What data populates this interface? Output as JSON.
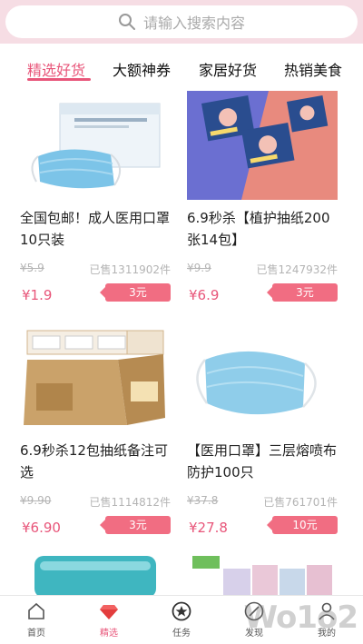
{
  "search": {
    "placeholder": "请输入搜索内容"
  },
  "tabs": [
    {
      "label": "精选好货"
    },
    {
      "label": "大额神券"
    },
    {
      "label": "家居好货"
    },
    {
      "label": "热销美食"
    }
  ],
  "products": [
    {
      "title": "全国包邮！成人医用口罩10只装",
      "orig_price": "¥5.9",
      "sold": "已售1311902件",
      "price": "¥1.9",
      "coupon": "3元"
    },
    {
      "title": "6.9秒杀【植护抽纸200张14包】",
      "orig_price": "¥9.9",
      "sold": "已售1247932件",
      "price": "¥6.9",
      "coupon": "3元"
    },
    {
      "title": "6.9秒杀12包抽纸备注可选",
      "orig_price": "¥9.90",
      "sold": "已售1114812件",
      "price": "¥6.90",
      "coupon": "3元"
    },
    {
      "title": "【医用口罩】三层熔喷布防护100只",
      "orig_price": "¥37.8",
      "sold": "已售761701件",
      "price": "¥27.8",
      "coupon": "10元"
    }
  ],
  "tabbar": [
    {
      "label": "首页",
      "icon": "home-icon"
    },
    {
      "label": "精选",
      "icon": "diamond-icon"
    },
    {
      "label": "任务",
      "icon": "star-badge-icon"
    },
    {
      "label": "发现",
      "icon": "compass-icon"
    },
    {
      "label": "我的",
      "icon": "user-icon"
    }
  ],
  "watermark": "Wo1o2",
  "colors": {
    "accent": "#e8567a",
    "coupon": "#f16d82",
    "top_band": "#f6dde4"
  }
}
